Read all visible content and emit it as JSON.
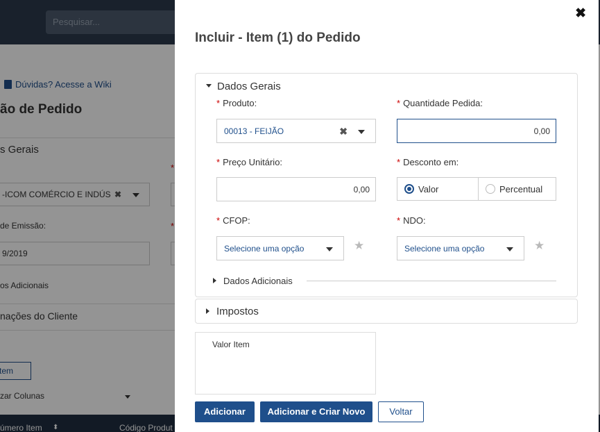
{
  "background": {
    "search_placeholder": "Pesquisar...",
    "wiki_link": "Dúvidas? Acesse a Wiki",
    "page_title": "ão de Pedido",
    "section_dados_gerais": "s Gerais",
    "client_value": "-ICOM COMÉRCIO E INDÚS",
    "emission_label": "de Emissão:",
    "emission_value": "9/2019",
    "dados_adicionais": "os Adicionais",
    "info_cliente": "nações do Cliente",
    "item_button": "tem",
    "columns_label": "zar Colunas",
    "col_numero_item": "úmero Item",
    "col_codigo": "Código Produt"
  },
  "modal": {
    "title": "Incluir - Item (1) do Pedido",
    "close_symbol": "✖",
    "dados_gerais": {
      "title": "Dados Gerais",
      "produto": {
        "label": "Produto:",
        "value": "00013 - FEIJÃO"
      },
      "quantidade": {
        "label": "Quantidade Pedida:",
        "value": "0,00"
      },
      "preco": {
        "label": "Preço Unitário:",
        "value": "0,00"
      },
      "desconto": {
        "label": "Desconto em:",
        "options": [
          "Valor",
          "Percentual"
        ],
        "selected": "Valor"
      },
      "cfop": {
        "label": "CFOP:",
        "placeholder": "Selecione uma opção"
      },
      "ndo": {
        "label": "NDO:",
        "placeholder": "Selecione uma opção"
      },
      "dados_adicionais": "Dados Adicionais"
    },
    "impostos": "Impostos",
    "valor_item": "Valor Item",
    "buttons": {
      "adicionar": "Adicionar",
      "adicionar_novo": "Adicionar e Criar Novo",
      "voltar": "Voltar"
    },
    "required_mark": "*",
    "clear_symbol": "✖",
    "star_symbol": "★"
  }
}
